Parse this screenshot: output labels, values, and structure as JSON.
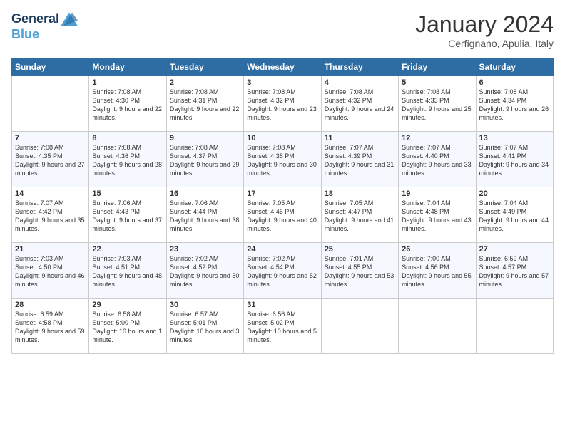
{
  "header": {
    "logo_line1": "General",
    "logo_line2": "Blue",
    "month": "January 2024",
    "location": "Cerfignano, Apulia, Italy"
  },
  "weekdays": [
    "Sunday",
    "Monday",
    "Tuesday",
    "Wednesday",
    "Thursday",
    "Friday",
    "Saturday"
  ],
  "weeks": [
    [
      {
        "day": "",
        "sunrise": "",
        "sunset": "",
        "daylight": ""
      },
      {
        "day": "1",
        "sunrise": "Sunrise: 7:08 AM",
        "sunset": "Sunset: 4:30 PM",
        "daylight": "Daylight: 9 hours and 22 minutes."
      },
      {
        "day": "2",
        "sunrise": "Sunrise: 7:08 AM",
        "sunset": "Sunset: 4:31 PM",
        "daylight": "Daylight: 9 hours and 22 minutes."
      },
      {
        "day": "3",
        "sunrise": "Sunrise: 7:08 AM",
        "sunset": "Sunset: 4:32 PM",
        "daylight": "Daylight: 9 hours and 23 minutes."
      },
      {
        "day": "4",
        "sunrise": "Sunrise: 7:08 AM",
        "sunset": "Sunset: 4:32 PM",
        "daylight": "Daylight: 9 hours and 24 minutes."
      },
      {
        "day": "5",
        "sunrise": "Sunrise: 7:08 AM",
        "sunset": "Sunset: 4:33 PM",
        "daylight": "Daylight: 9 hours and 25 minutes."
      },
      {
        "day": "6",
        "sunrise": "Sunrise: 7:08 AM",
        "sunset": "Sunset: 4:34 PM",
        "daylight": "Daylight: 9 hours and 26 minutes."
      }
    ],
    [
      {
        "day": "7",
        "sunrise": "Sunrise: 7:08 AM",
        "sunset": "Sunset: 4:35 PM",
        "daylight": "Daylight: 9 hours and 27 minutes."
      },
      {
        "day": "8",
        "sunrise": "Sunrise: 7:08 AM",
        "sunset": "Sunset: 4:36 PM",
        "daylight": "Daylight: 9 hours and 28 minutes."
      },
      {
        "day": "9",
        "sunrise": "Sunrise: 7:08 AM",
        "sunset": "Sunset: 4:37 PM",
        "daylight": "Daylight: 9 hours and 29 minutes."
      },
      {
        "day": "10",
        "sunrise": "Sunrise: 7:08 AM",
        "sunset": "Sunset: 4:38 PM",
        "daylight": "Daylight: 9 hours and 30 minutes."
      },
      {
        "day": "11",
        "sunrise": "Sunrise: 7:07 AM",
        "sunset": "Sunset: 4:39 PM",
        "daylight": "Daylight: 9 hours and 31 minutes."
      },
      {
        "day": "12",
        "sunrise": "Sunrise: 7:07 AM",
        "sunset": "Sunset: 4:40 PM",
        "daylight": "Daylight: 9 hours and 33 minutes."
      },
      {
        "day": "13",
        "sunrise": "Sunrise: 7:07 AM",
        "sunset": "Sunset: 4:41 PM",
        "daylight": "Daylight: 9 hours and 34 minutes."
      }
    ],
    [
      {
        "day": "14",
        "sunrise": "Sunrise: 7:07 AM",
        "sunset": "Sunset: 4:42 PM",
        "daylight": "Daylight: 9 hours and 35 minutes."
      },
      {
        "day": "15",
        "sunrise": "Sunrise: 7:06 AM",
        "sunset": "Sunset: 4:43 PM",
        "daylight": "Daylight: 9 hours and 37 minutes."
      },
      {
        "day": "16",
        "sunrise": "Sunrise: 7:06 AM",
        "sunset": "Sunset: 4:44 PM",
        "daylight": "Daylight: 9 hours and 38 minutes."
      },
      {
        "day": "17",
        "sunrise": "Sunrise: 7:05 AM",
        "sunset": "Sunset: 4:46 PM",
        "daylight": "Daylight: 9 hours and 40 minutes."
      },
      {
        "day": "18",
        "sunrise": "Sunrise: 7:05 AM",
        "sunset": "Sunset: 4:47 PM",
        "daylight": "Daylight: 9 hours and 41 minutes."
      },
      {
        "day": "19",
        "sunrise": "Sunrise: 7:04 AM",
        "sunset": "Sunset: 4:48 PM",
        "daylight": "Daylight: 9 hours and 43 minutes."
      },
      {
        "day": "20",
        "sunrise": "Sunrise: 7:04 AM",
        "sunset": "Sunset: 4:49 PM",
        "daylight": "Daylight: 9 hours and 44 minutes."
      }
    ],
    [
      {
        "day": "21",
        "sunrise": "Sunrise: 7:03 AM",
        "sunset": "Sunset: 4:50 PM",
        "daylight": "Daylight: 9 hours and 46 minutes."
      },
      {
        "day": "22",
        "sunrise": "Sunrise: 7:03 AM",
        "sunset": "Sunset: 4:51 PM",
        "daylight": "Daylight: 9 hours and 48 minutes."
      },
      {
        "day": "23",
        "sunrise": "Sunrise: 7:02 AM",
        "sunset": "Sunset: 4:52 PM",
        "daylight": "Daylight: 9 hours and 50 minutes."
      },
      {
        "day": "24",
        "sunrise": "Sunrise: 7:02 AM",
        "sunset": "Sunset: 4:54 PM",
        "daylight": "Daylight: 9 hours and 52 minutes."
      },
      {
        "day": "25",
        "sunrise": "Sunrise: 7:01 AM",
        "sunset": "Sunset: 4:55 PM",
        "daylight": "Daylight: 9 hours and 53 minutes."
      },
      {
        "day": "26",
        "sunrise": "Sunrise: 7:00 AM",
        "sunset": "Sunset: 4:56 PM",
        "daylight": "Daylight: 9 hours and 55 minutes."
      },
      {
        "day": "27",
        "sunrise": "Sunrise: 6:59 AM",
        "sunset": "Sunset: 4:57 PM",
        "daylight": "Daylight: 9 hours and 57 minutes."
      }
    ],
    [
      {
        "day": "28",
        "sunrise": "Sunrise: 6:59 AM",
        "sunset": "Sunset: 4:58 PM",
        "daylight": "Daylight: 9 hours and 59 minutes."
      },
      {
        "day": "29",
        "sunrise": "Sunrise: 6:58 AM",
        "sunset": "Sunset: 5:00 PM",
        "daylight": "Daylight: 10 hours and 1 minute."
      },
      {
        "day": "30",
        "sunrise": "Sunrise: 6:57 AM",
        "sunset": "Sunset: 5:01 PM",
        "daylight": "Daylight: 10 hours and 3 minutes."
      },
      {
        "day": "31",
        "sunrise": "Sunrise: 6:56 AM",
        "sunset": "Sunset: 5:02 PM",
        "daylight": "Daylight: 10 hours and 5 minutes."
      },
      {
        "day": "",
        "sunrise": "",
        "sunset": "",
        "daylight": ""
      },
      {
        "day": "",
        "sunrise": "",
        "sunset": "",
        "daylight": ""
      },
      {
        "day": "",
        "sunrise": "",
        "sunset": "",
        "daylight": ""
      }
    ]
  ]
}
